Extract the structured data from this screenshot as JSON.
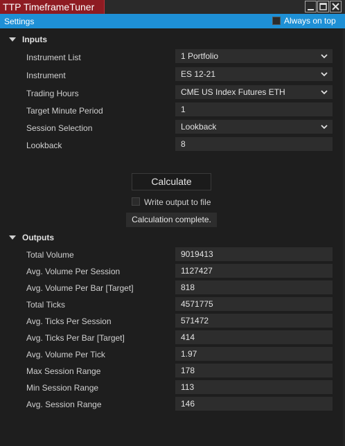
{
  "window": {
    "title": "TTP TimeframeTuner"
  },
  "settings_bar": {
    "label": "Settings",
    "always_on_top_label": "Always on top",
    "always_on_top_checked": false
  },
  "inputs": {
    "section_title": "Inputs",
    "instrument_list": {
      "label": "Instrument List",
      "value": "1 Portfolio"
    },
    "instrument": {
      "label": "Instrument",
      "value": "ES 12-21"
    },
    "trading_hours": {
      "label": "Trading Hours",
      "value": "CME US Index Futures ETH"
    },
    "target_minute_period": {
      "label": "Target Minute Period",
      "value": "1"
    },
    "session_selection": {
      "label": "Session Selection",
      "value": "Lookback"
    },
    "lookback": {
      "label": "Lookback",
      "value": "8"
    }
  },
  "actions": {
    "calculate_label": "Calculate",
    "write_output_label": "Write output to file",
    "write_output_checked": false,
    "status_text": "Calculation complete."
  },
  "outputs": {
    "section_title": "Outputs",
    "rows": [
      {
        "label": "Total Volume",
        "value": "9019413"
      },
      {
        "label": "Avg. Volume Per Session",
        "value": "1127427"
      },
      {
        "label": "Avg. Volume Per Bar [Target]",
        "value": "818"
      },
      {
        "label": "Total Ticks",
        "value": "4571775"
      },
      {
        "label": "Avg. Ticks Per Session",
        "value": "571472"
      },
      {
        "label": "Avg. Ticks Per Bar [Target]",
        "value": "414"
      },
      {
        "label": "Avg. Volume Per Tick",
        "value": "1.97"
      },
      {
        "label": "Max Session Range",
        "value": "178"
      },
      {
        "label": "Min Session Range",
        "value": "113"
      },
      {
        "label": "Avg. Session Range",
        "value": "146"
      }
    ]
  },
  "colors": {
    "title_tab": "#8e1b22",
    "settings_bar": "#1e90d6",
    "background": "#1e1e1e",
    "field": "#2d2d2d"
  }
}
